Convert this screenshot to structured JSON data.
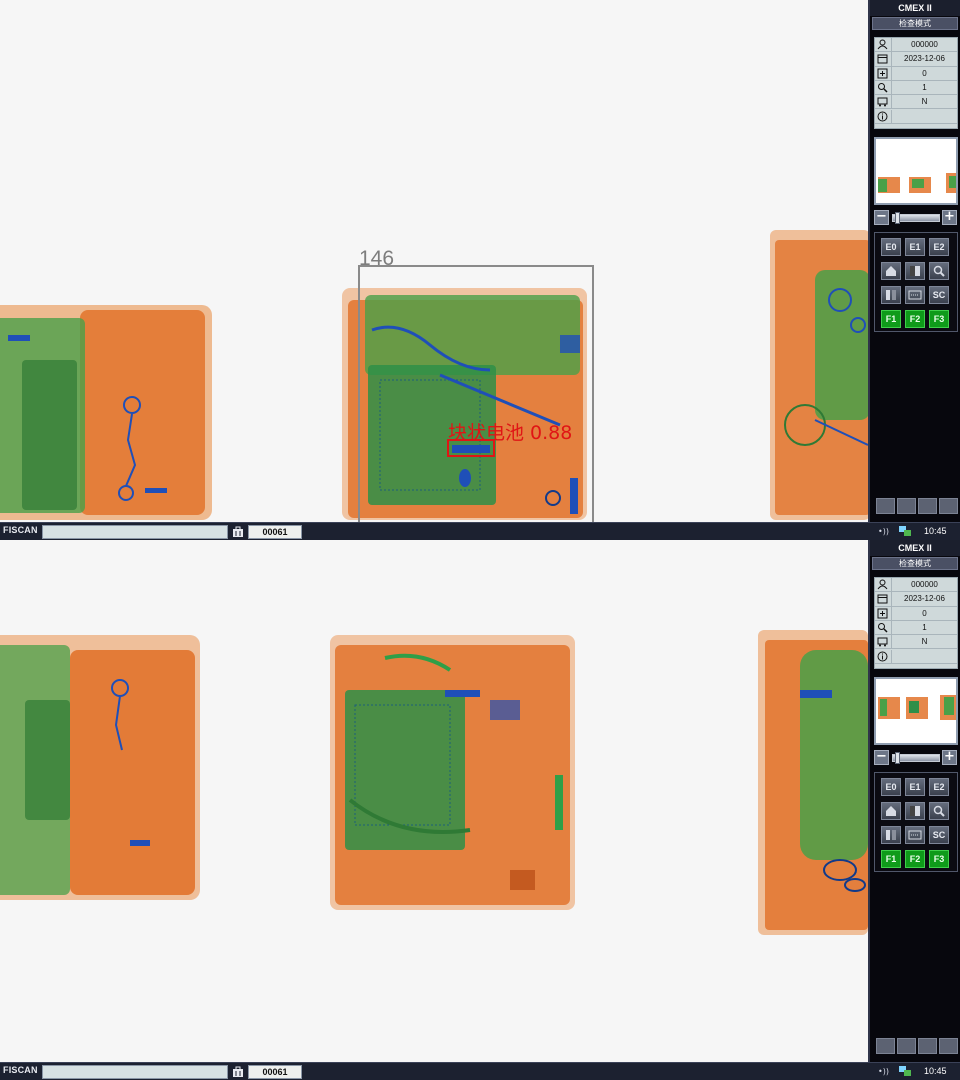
{
  "screens": [
    {
      "panel": {
        "title": "CMEX II",
        "mode": "检查模式",
        "info": [
          {
            "icon": "user-icon",
            "value": "000000"
          },
          {
            "icon": "calendar-icon",
            "value": "2023-12-06"
          },
          {
            "icon": "counter-icon",
            "value": "0"
          },
          {
            "icon": "magnifier-icon",
            "value": "1"
          },
          {
            "icon": "machine-icon",
            "value": "N"
          },
          {
            "icon": "info-icon",
            "value": ""
          }
        ],
        "keys": [
          "E0",
          "E1",
          "E2",
          "",
          "",
          "",
          "",
          "",
          "SC",
          "F1",
          "F2",
          "F3"
        ]
      },
      "status": {
        "brand": "FISCAN",
        "field": "",
        "counter": "00061",
        "clock": "10:45"
      },
      "detection": {
        "box_id": "146",
        "label": "块状电池 0.88"
      }
    },
    {
      "panel": {
        "title": "CMEX II",
        "mode": "检查模式",
        "info": [
          {
            "icon": "user-icon",
            "value": "000000"
          },
          {
            "icon": "calendar-icon",
            "value": "2023-12-06"
          },
          {
            "icon": "counter-icon",
            "value": "0"
          },
          {
            "icon": "magnifier-icon",
            "value": "1"
          },
          {
            "icon": "machine-icon",
            "value": "N"
          },
          {
            "icon": "info-icon",
            "value": ""
          }
        ],
        "keys": [
          "E0",
          "E1",
          "E2",
          "",
          "",
          "",
          "",
          "",
          "SC",
          "F1",
          "F2",
          "F3"
        ]
      },
      "status": {
        "brand": "FISCAN",
        "field": "",
        "counter": "00061",
        "clock": "10:45"
      }
    }
  ],
  "colors": {
    "organic": "#e06a1e",
    "mixed": "#3f9a3c",
    "metal": "#1f4fb8",
    "detection": "#e01515",
    "panel": "#07070d"
  }
}
